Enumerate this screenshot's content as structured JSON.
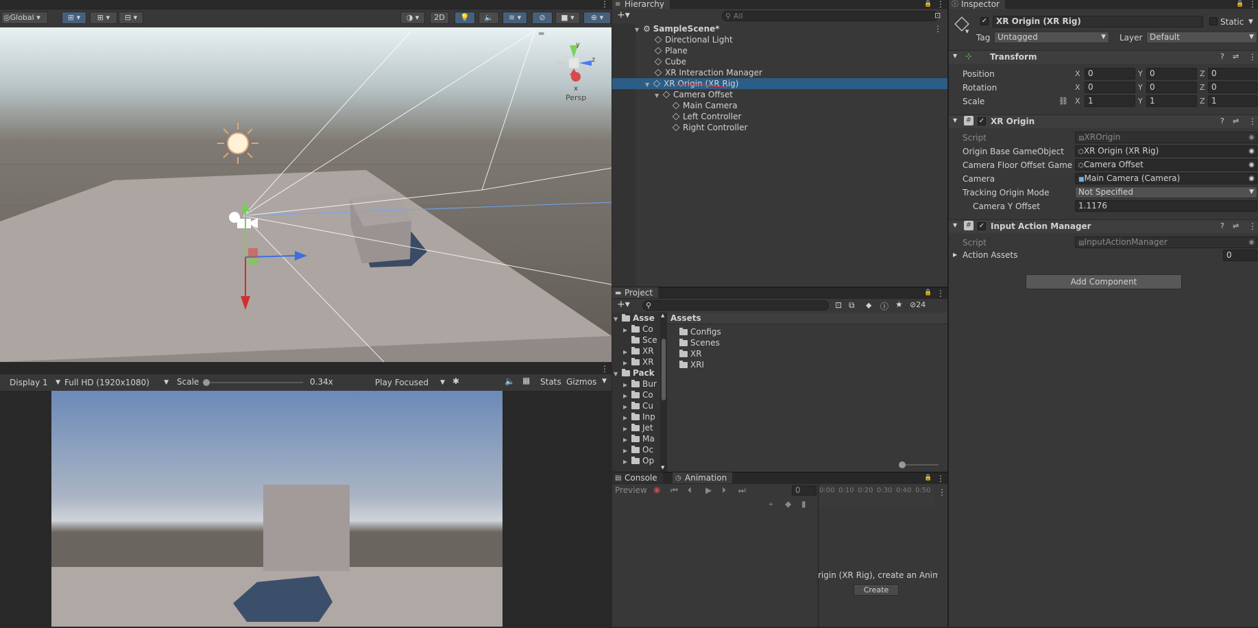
{
  "scene_toolbar": {
    "global_label": "Global",
    "btn_2d": "2D",
    "persp_label": "Persp",
    "gizmo_axes": {
      "y": "y",
      "z": "z",
      "x": "x"
    }
  },
  "game_toolbar": {
    "display": "Display 1",
    "resolution": "Full HD (1920x1080)",
    "scale_label": "Scale",
    "scale_value": "0.34x",
    "play_mode": "Play Focused",
    "stats": "Stats",
    "gizmos": "Gizmos"
  },
  "hierarchy": {
    "tab": "Hierarchy",
    "search_placeholder": "All",
    "scene": "SampleScene*",
    "items": [
      {
        "label": "Directional Light"
      },
      {
        "label": "Plane"
      },
      {
        "label": "Cube"
      },
      {
        "label": "XR Interaction Manager"
      },
      {
        "label": "XR Origin (XR Rig)"
      },
      {
        "label": "Camera Offset"
      },
      {
        "label": "Main Camera"
      },
      {
        "label": "Left Controller"
      },
      {
        "label": "Right Controller"
      }
    ]
  },
  "project": {
    "tab": "Project",
    "visible_count": "24",
    "assets_header": "Assets",
    "tree": [
      {
        "label": "Asse"
      },
      {
        "label": "Co"
      },
      {
        "label": "Sce"
      },
      {
        "label": "XR"
      },
      {
        "label": "XR"
      },
      {
        "label": "Pack"
      },
      {
        "label": "Bur"
      },
      {
        "label": "Co"
      },
      {
        "label": "Cu"
      },
      {
        "label": "Inp"
      },
      {
        "label": "Jet"
      },
      {
        "label": "Ma"
      },
      {
        "label": "Oc"
      },
      {
        "label": "Op"
      }
    ],
    "folders": [
      {
        "label": "Configs"
      },
      {
        "label": "Scenes"
      },
      {
        "label": "XR"
      },
      {
        "label": "XRI"
      }
    ]
  },
  "bottom": {
    "tab_console": "Console",
    "tab_animation": "Animation",
    "preview": "Preview",
    "frame": "0",
    "ticks": [
      "0:00",
      "0:10",
      "0:20",
      "0:30",
      "0:40",
      "0:50"
    ],
    "message": "rigin (XR Rig), create an Animat",
    "create": "Create"
  },
  "inspector": {
    "tab": "Inspector",
    "object_name": "XR Origin (XR Rig)",
    "static_label": "Static",
    "tag_label": "Tag",
    "tag_value": "Untagged",
    "layer_label": "Layer",
    "layer_value": "Default",
    "transform": {
      "title": "Transform",
      "position_label": "Position",
      "rotation_label": "Rotation",
      "scale_label": "Scale",
      "axes": [
        "X",
        "Y",
        "Z"
      ],
      "position": [
        "0",
        "0",
        "0"
      ],
      "rotation": [
        "0",
        "0",
        "0"
      ],
      "scale": [
        "1",
        "1",
        "1"
      ]
    },
    "xr_origin": {
      "title": "XR Origin",
      "script_label": "Script",
      "script_value": "XROrigin",
      "origin_base_label": "Origin Base GameObject",
      "origin_base_value": "XR Origin (XR Rig)",
      "floor_offset_label": "Camera Floor Offset GameOb",
      "floor_offset_value": "Camera Offset",
      "camera_label": "Camera",
      "camera_value": "Main Camera (Camera)",
      "tracking_label": "Tracking Origin Mode",
      "tracking_value": "Not Specified",
      "y_offset_label": "Camera Y Offset",
      "y_offset_value": "1.1176"
    },
    "input_action": {
      "title": "Input Action Manager",
      "script_label": "Script",
      "script_value": "InputActionManager",
      "assets_label": "Action Assets",
      "assets_value": "0"
    },
    "add_component": "Add Component"
  },
  "colors": {
    "selection": "#2c5d87",
    "accent_blue": "#46607c"
  }
}
